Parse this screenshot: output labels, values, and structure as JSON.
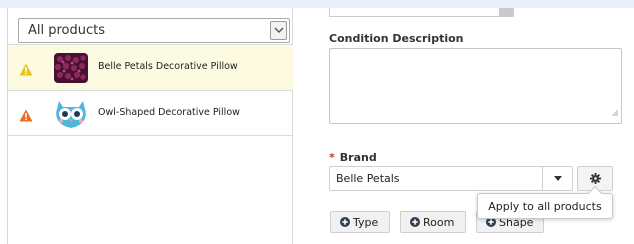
{
  "filter": {
    "selected": "All products"
  },
  "products": [
    {
      "name": "Belle Petals Decorative Pillow",
      "warning_color": "#e8c41a",
      "selected": true,
      "thumb_icon": "purple-petal-pillow"
    },
    {
      "name": "Owl-Shaped Decorative Pillow",
      "warning_color": "#ef6b23",
      "selected": false,
      "thumb_icon": "blue-owl-pillow"
    }
  ],
  "form": {
    "condition_label": "Condition Description",
    "condition_value": "",
    "brand_required_mark": "*",
    "brand_label": "Brand",
    "brand_value": "Belle Petals",
    "tooltip_text": "Apply to all products",
    "buttons": [
      {
        "label": "Type",
        "icon": "plus-circle-icon"
      },
      {
        "label": "Room",
        "icon": "plus-circle-icon"
      },
      {
        "label": "Shape",
        "icon": "plus-circle-icon"
      }
    ]
  },
  "colors": {
    "selected_row": "#fcfbe2",
    "required_mark": "#d9262c",
    "warning_yellow": "#e8c41a",
    "warning_orange": "#ef6b23"
  }
}
